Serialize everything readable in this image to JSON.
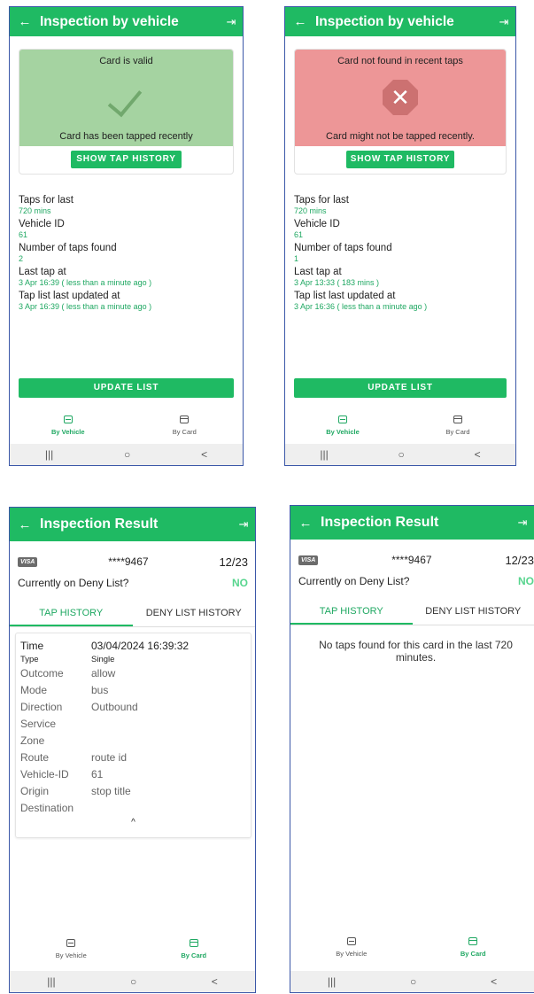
{
  "screen1": {
    "title": "Inspection by vehicle",
    "back_icon": "←",
    "exit_icon": "⇥",
    "status_title": "Card is valid",
    "status_sub": "Card has been tapped recently",
    "status_color": "#a5d3a1",
    "show_tap_history": "SHOW TAP HISTORY",
    "taps_for_last_label": "Taps for last",
    "taps_for_last_value": "720 mins",
    "vehicle_id_label": "Vehicle ID",
    "vehicle_id_value": "61",
    "num_taps_label": "Number of taps found",
    "num_taps_value": "2",
    "last_tap_label": "Last tap at",
    "last_tap_value": "3 Apr 16:39 ( less than a minute ago )",
    "updated_label": "Tap list last updated at",
    "updated_value": "3 Apr 16:39 ( less than a minute ago )",
    "update_list": "UPDATE LIST",
    "nav": {
      "vehicle": "By Vehicle",
      "card": "By Card",
      "active": "vehicle"
    }
  },
  "screen2": {
    "title": "Inspection by vehicle",
    "back_icon": "←",
    "exit_icon": "⇥",
    "status_title": "Card not found in recent taps",
    "status_sub": "Card might not be tapped recently.",
    "status_color": "#ed9697",
    "show_tap_history": "SHOW TAP HISTORY",
    "taps_for_last_label": "Taps for last",
    "taps_for_last_value": "720 mins",
    "vehicle_id_label": "Vehicle ID",
    "vehicle_id_value": "61",
    "num_taps_label": "Number of taps found",
    "num_taps_value": "1",
    "last_tap_label": "Last tap at",
    "last_tap_value": "3 Apr 13:33 ( 183 mins )",
    "updated_label": "Tap list last updated at",
    "updated_value": "3 Apr 16:36 ( less than a minute ago )",
    "update_list": "UPDATE LIST",
    "nav": {
      "vehicle": "By Vehicle",
      "card": "By Card",
      "active": "vehicle"
    }
  },
  "screen3": {
    "title": "Inspection Result",
    "back_icon": "←",
    "exit_icon": "⇥",
    "card_brand": "VISA",
    "masked_pan": "****9467",
    "expiry": "12/23",
    "deny_question": "Currently on Deny List?",
    "deny_answer": "NO",
    "tabs": [
      "TAP HISTORY",
      "DENY LIST HISTORY"
    ],
    "history": {
      "time_k": "Time",
      "time_v": "03/04/2024 16:39:32",
      "type_k": "Type",
      "type_v": "Single",
      "outcome_k": "Outcome",
      "outcome_v": "allow",
      "mode_k": "Mode",
      "mode_v": "bus",
      "direction_k": "Direction",
      "direction_v": "Outbound",
      "service_k": "Service",
      "service_v": "",
      "zone_k": "Zone",
      "zone_v": "",
      "route_k": "Route",
      "route_v": "route id",
      "vehicle_k": "Vehicle-ID",
      "vehicle_v": "61",
      "origin_k": "Origin",
      "origin_v": "stop title",
      "destination_k": "Destination",
      "destination_v": "",
      "collapse_icon": "^"
    },
    "nav": {
      "vehicle": "By Vehicle",
      "card": "By Card",
      "active": "card"
    }
  },
  "screen4": {
    "title": "Inspection Result",
    "back_icon": "←",
    "exit_icon": "⇥",
    "card_brand": "VISA",
    "masked_pan": "****9467",
    "expiry": "12/23",
    "deny_question": "Currently on Deny List?",
    "deny_answer": "NO",
    "tabs": [
      "TAP HISTORY",
      "DENY LIST HISTORY"
    ],
    "no_taps": "No taps found for this card in the last 720 minutes.",
    "nav": {
      "vehicle": "By Vehicle",
      "card": "By Card",
      "active": "card"
    }
  },
  "system_nav": {
    "recents": "|||",
    "home": "○",
    "back": "<"
  }
}
